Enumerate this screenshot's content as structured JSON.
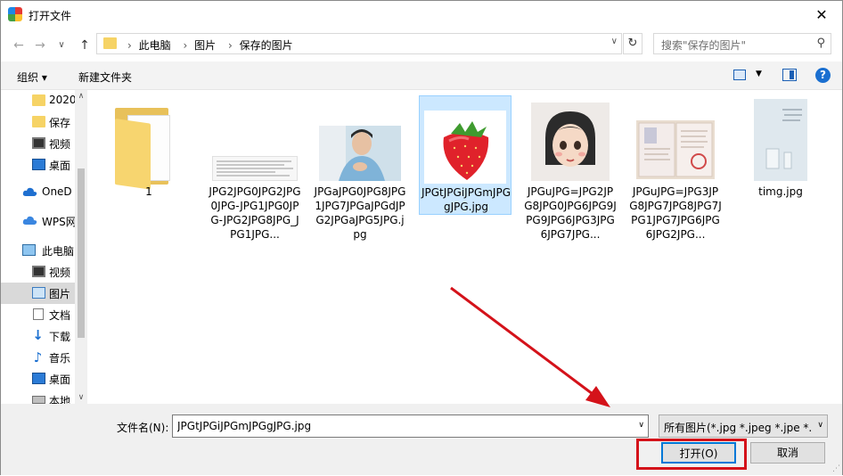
{
  "window": {
    "title": "打开文件",
    "close": "✕"
  },
  "nav": {
    "back": "←",
    "forward": "→",
    "down": "∨",
    "up": "↑"
  },
  "address": {
    "crumbs": [
      "此电脑",
      "图片",
      "保存的图片"
    ],
    "separator": "›",
    "dropdown": "∨",
    "refresh": "↻"
  },
  "search": {
    "placeholder": "搜索\"保存的图片\"",
    "icon": "⚲"
  },
  "toolbar": {
    "organize": "组织 ▾",
    "new_folder": "新建文件夹",
    "help": "?"
  },
  "sidebar": {
    "items": [
      {
        "label": "2020",
        "icon": "folder-icon"
      },
      {
        "label": "保存",
        "icon": "folder-icon"
      },
      {
        "label": "视频",
        "icon": "video-icon"
      },
      {
        "label": "桌面",
        "icon": "desktop-icon"
      },
      {
        "label": "OneD",
        "icon": "onedrive-icon"
      },
      {
        "label": "WPS网",
        "icon": "wps-cloud-icon"
      },
      {
        "label": "此电脑",
        "icon": "computer-icon"
      },
      {
        "label": "视频",
        "icon": "video-icon"
      },
      {
        "label": "图片",
        "icon": "pictures-icon"
      },
      {
        "label": "文档",
        "icon": "documents-icon"
      },
      {
        "label": "下载",
        "icon": "download-icon"
      },
      {
        "label": "音乐",
        "icon": "music-icon"
      },
      {
        "label": "桌面",
        "icon": "desktop-icon"
      },
      {
        "label": "本地",
        "icon": "drive-icon"
      }
    ],
    "scroll_up": "∧",
    "scroll_down": "∨"
  },
  "files": [
    {
      "name": "1",
      "type": "folder"
    },
    {
      "name": "JPG2JPG0JPG2JPG0JPG-JPG1JPG0JPG-JPG2JPG8JPG_JPG1JPG...",
      "type": "image"
    },
    {
      "name": "JPGaJPG0JPG8JPG1JPG7JPGaJPGdJPG2JPGaJPG5JPG.jpg",
      "type": "image"
    },
    {
      "name": "JPGtJPGiJPGmJPGgJPG.jpg",
      "type": "image",
      "selected": true
    },
    {
      "name": "JPGuJPG=JPG2JPG8JPG0JPG6JPG9JPG9JPG6JPG3JPG6JPG7JPG...",
      "type": "image"
    },
    {
      "name": "JPGuJPG=JPG3JPG8JPG7JPG8JPG7JPG1JPG7JPG6JPG6JPG2JPG...",
      "type": "image"
    },
    {
      "name": "timg.jpg",
      "type": "image"
    }
  ],
  "bottom": {
    "filename_label": "文件名(N):",
    "filename_value": "JPGtJPGiJPGmJPGgJPG.jpg",
    "filter_value": "所有图片(*.jpg *.jpeg *.jpe *.b",
    "open_label": "打开(O)",
    "cancel_label": "取消"
  },
  "colors": {
    "accent": "#0078d7",
    "selection": "#cce8ff",
    "annotation": "#d4121a"
  }
}
